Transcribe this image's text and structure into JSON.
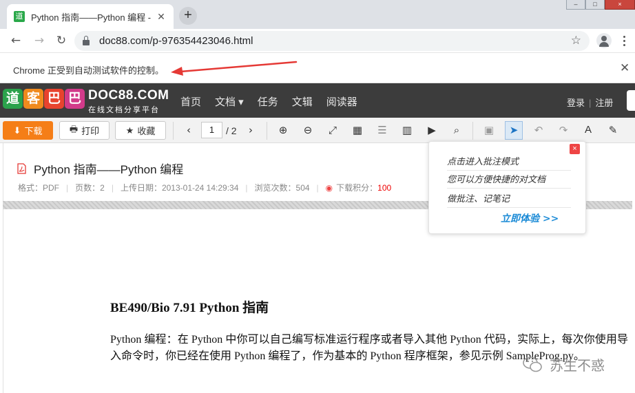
{
  "browser": {
    "tab_title": "Python 指南——Python 编程 -",
    "tab_favicon_glyph": "道",
    "new_tab_glyph": "+",
    "url": "doc88.com/p-976354423046.html",
    "infobar_text": "Chrome 正受到自动测试软件的控制。",
    "window_controls": {
      "minimize": "–",
      "maximize": "□",
      "close": "×"
    }
  },
  "site": {
    "logo_tiles": [
      {
        "char": "道",
        "color": "#2ba24c"
      },
      {
        "char": "客",
        "color": "#f08a1e"
      },
      {
        "char": "巴",
        "color": "#e8432e"
      },
      {
        "char": "巴",
        "color": "#d23a8a"
      }
    ],
    "brand_name": "DOC88.COM",
    "brand_tagline": "在线文档分享平台",
    "nav": [
      "首页",
      "文档 ▾",
      "任务",
      "文辑",
      "阅读器"
    ],
    "login": "登录",
    "register": "注册"
  },
  "reader_toolbar": {
    "download_label": "下载",
    "print_label": "打印",
    "favorite_label": "收藏",
    "current_page": "1",
    "total_pages": "/ 2"
  },
  "document": {
    "title": "Python 指南——Python 编程",
    "meta": {
      "format": "格式：PDF",
      "pages": "页数：2",
      "upload_date": "上传日期：2013-01-24 14:29:34",
      "views": "浏览次数：504",
      "points_label": "下载积分：",
      "points_value": "100"
    },
    "heading": "BE490/Bio 7.91 Python  指南",
    "paragraph": "Python  编程：在 Python 中你可以自己编写标准运行程序或者导入其他 Python 代码，实际上，每次你使用导入命令时，你已经在使用 Python 编程了，作为基本的 Python 程序框架，参见示例 SampleProg.py。"
  },
  "popup": {
    "lines": [
      "点击进入批注模式",
      "您可以方便快捷的对文档",
      "做批注、记笔记"
    ],
    "cta": "立即体验 >>",
    "close": "×"
  },
  "watermark": {
    "text": "苏生不惑"
  },
  "colors": {
    "accent_orange": "#f57e17",
    "header_bg": "#3c3c3c",
    "link_blue": "#1a8ad6",
    "annotation_arrow": "#e53935"
  }
}
